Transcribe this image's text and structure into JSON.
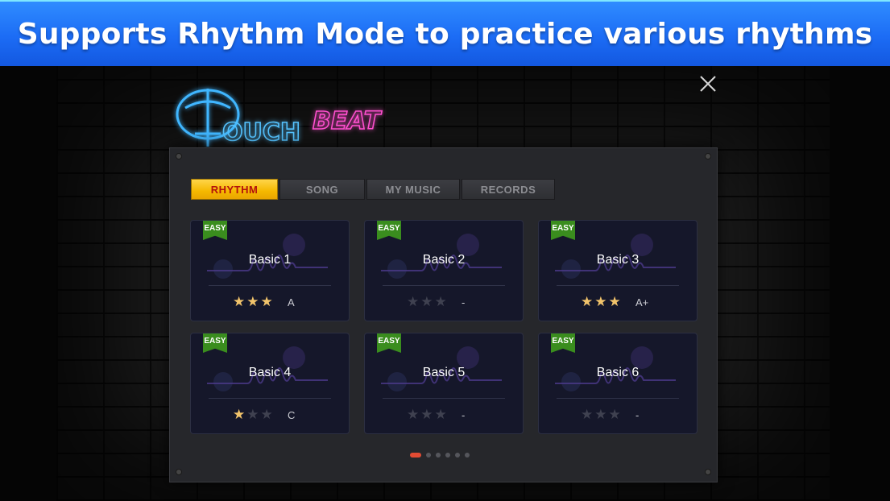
{
  "banner": {
    "text": "Supports Rhythm Mode to practice various rhythms"
  },
  "logo": {
    "text_main": "OUCH",
    "text_beat": "BEAT",
    "initial": "T"
  },
  "tabs": [
    {
      "label": "RHYTHM",
      "active": true
    },
    {
      "label": "SONG",
      "active": false
    },
    {
      "label": "MY MUSIC",
      "active": false
    },
    {
      "label": "RECORDS",
      "active": false
    }
  ],
  "cards": [
    {
      "badge": "EASY",
      "title": "Basic 1",
      "stars": 3,
      "grade": "A"
    },
    {
      "badge": "EASY",
      "title": "Basic 2",
      "stars": 0,
      "grade": "-"
    },
    {
      "badge": "EASY",
      "title": "Basic 3",
      "stars": 3,
      "grade": "A+"
    },
    {
      "badge": "EASY",
      "title": "Basic 4",
      "stars": 1,
      "grade": "C"
    },
    {
      "badge": "EASY",
      "title": "Basic 5",
      "stars": 0,
      "grade": "-"
    },
    {
      "badge": "EASY",
      "title": "Basic 6",
      "stars": 0,
      "grade": "-"
    }
  ],
  "pager": {
    "pages": 6,
    "current": 1
  },
  "colors": {
    "banner": "#1c6cf5",
    "active_tab": "#f5b800",
    "star": "#f2c46b",
    "badge": "#3a8d1e",
    "pager_active": "#e24b33"
  },
  "icons": {
    "close": "close-icon",
    "star": "star-icon"
  }
}
